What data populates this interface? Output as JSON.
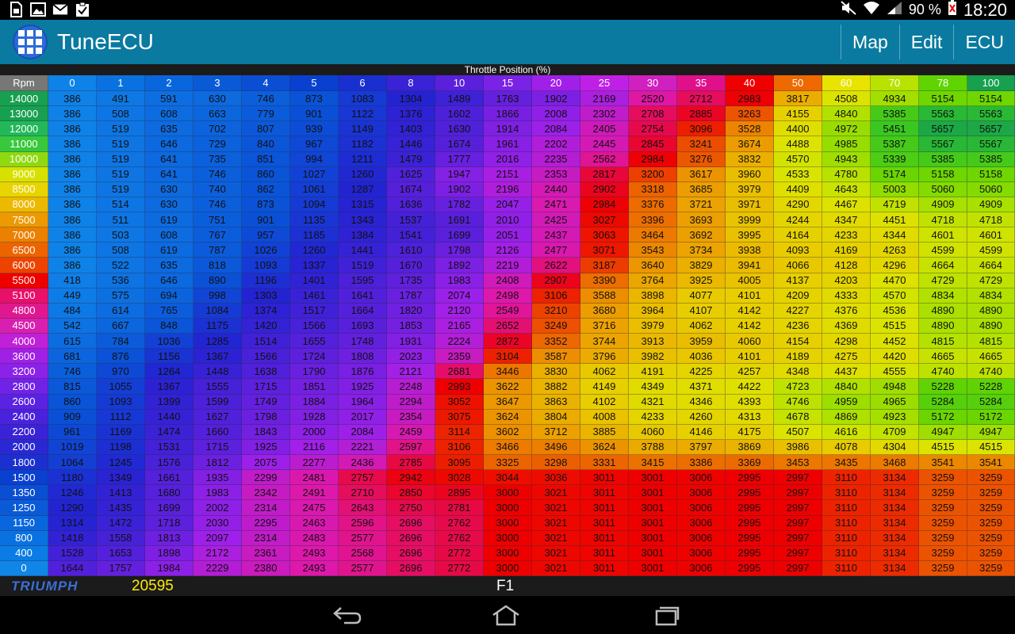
{
  "status_bar": {
    "left_icons": [
      "sim-card-icon",
      "image-icon",
      "gmail-icon",
      "clipboard-check-icon"
    ],
    "right_icons": [
      "mute-icon",
      "wifi-icon",
      "signal-icon"
    ],
    "battery": "90 %",
    "time": "18:20"
  },
  "app_bar": {
    "title": "TuneECU",
    "actions": [
      "Map",
      "Edit",
      "ECU"
    ]
  },
  "table": {
    "title": "Throttle Position (%)",
    "corner_label": "Rpm",
    "columns": [
      "0",
      "1",
      "2",
      "3",
      "4",
      "5",
      "6",
      "8",
      "10",
      "15",
      "20",
      "25",
      "30",
      "35",
      "40",
      "50",
      "60",
      "70",
      "78",
      "100"
    ],
    "column_colors": [
      "#0f82e8",
      "#0a72e0",
      "#0a66dd",
      "#0a5ad8",
      "#0a4ed4",
      "#0a40d0",
      "#1a2fd0",
      "#3a22d6",
      "#5a20dc",
      "#7a22e6",
      "#a020ea",
      "#c020e6",
      "#d020c0",
      "#e0108a",
      "#ee0000",
      "#ee6a00",
      "#e8e400",
      "#b8e200",
      "#60d400",
      "#17a050"
    ],
    "rows": [
      {
        "rpm": "14000",
        "color": "#17a050",
        "values": [
          386,
          491,
          591,
          630,
          746,
          873,
          1083,
          1304,
          1489,
          1763,
          1902,
          2169,
          2520,
          2712,
          2983,
          3817,
          4508,
          4934,
          5154,
          5154
        ]
      },
      {
        "rpm": "13000",
        "color": "#17a050",
        "values": [
          386,
          508,
          608,
          663,
          779,
          901,
          1122,
          1376,
          1602,
          1866,
          2008,
          2302,
          2708,
          2885,
          3263,
          4155,
          4840,
          5385,
          5563,
          5563
        ]
      },
      {
        "rpm": "12000",
        "color": "#22b85a",
        "values": [
          386,
          519,
          635,
          702,
          807,
          939,
          1149,
          1403,
          1630,
          1914,
          2084,
          2405,
          2754,
          3096,
          3528,
          4400,
          4972,
          5451,
          5657,
          5657
        ]
      },
      {
        "rpm": "11000",
        "color": "#38c83c",
        "values": [
          386,
          519,
          646,
          729,
          840,
          967,
          1182,
          1446,
          1674,
          1961,
          2202,
          2445,
          2845,
          3241,
          3674,
          4488,
          4985,
          5387,
          5567,
          5567
        ]
      },
      {
        "rpm": "10000",
        "color": "#90d810",
        "values": [
          386,
          519,
          641,
          735,
          851,
          994,
          1211,
          1479,
          1777,
          2016,
          2235,
          2562,
          2984,
          3276,
          3832,
          4570,
          4943,
          5339,
          5385,
          5385
        ]
      },
      {
        "rpm": "9000",
        "color": "#d8e000",
        "values": [
          386,
          519,
          641,
          746,
          860,
          1027,
          1260,
          1625,
          1947,
          2151,
          2353,
          2817,
          3200,
          3617,
          3960,
          4533,
          4780,
          5174,
          5158,
          5158
        ]
      },
      {
        "rpm": "8500",
        "color": "#e8d400",
        "values": [
          386,
          519,
          630,
          740,
          862,
          1061,
          1287,
          1674,
          1902,
          2196,
          2440,
          2902,
          3318,
          3685,
          3979,
          4409,
          4643,
          5003,
          5060,
          5060
        ]
      },
      {
        "rpm": "8000",
        "color": "#ecb800",
        "values": [
          386,
          514,
          630,
          746,
          873,
          1094,
          1315,
          1636,
          1782,
          2047,
          2471,
          2984,
          3376,
          3721,
          3971,
          4290,
          4467,
          4719,
          4909,
          4909
        ]
      },
      {
        "rpm": "7500",
        "color": "#ec9a00",
        "values": [
          386,
          511,
          619,
          751,
          901,
          1135,
          1343,
          1537,
          1691,
          2010,
          2425,
          3027,
          3396,
          3693,
          3999,
          4244,
          4347,
          4451,
          4718,
          4718
        ]
      },
      {
        "rpm": "7000",
        "color": "#ec8000",
        "values": [
          386,
          503,
          608,
          767,
          957,
          1185,
          1384,
          1541,
          1699,
          2051,
          2437,
          3063,
          3464,
          3692,
          3995,
          4164,
          4233,
          4344,
          4601,
          4601
        ]
      },
      {
        "rpm": "6500",
        "color": "#ec6400",
        "values": [
          386,
          508,
          619,
          787,
          1026,
          1260,
          1441,
          1610,
          1798,
          2126,
          2477,
          3071,
          3543,
          3734,
          3938,
          4093,
          4169,
          4263,
          4599,
          4599
        ]
      },
      {
        "rpm": "6000",
        "color": "#ec4400",
        "values": [
          386,
          522,
          635,
          818,
          1093,
          1337,
          1519,
          1670,
          1892,
          2219,
          2622,
          3187,
          3640,
          3829,
          3941,
          4066,
          4128,
          4296,
          4664,
          4664
        ]
      },
      {
        "rpm": "5500",
        "color": "#ee0000",
        "values": [
          418,
          536,
          646,
          890,
          1196,
          1401,
          1595,
          1735,
          1983,
          2408,
          2907,
          3390,
          3764,
          3925,
          4005,
          4137,
          4203,
          4470,
          4729,
          4729
        ]
      },
      {
        "rpm": "5100",
        "color": "#e8106a",
        "values": [
          449,
          575,
          694,
          998,
          1303,
          1461,
          1641,
          1787,
          2074,
          2498,
          3106,
          3588,
          3898,
          4077,
          4101,
          4209,
          4333,
          4570,
          4834,
          4834
        ]
      },
      {
        "rpm": "4800",
        "color": "#e01890",
        "values": [
          484,
          614,
          765,
          1084,
          1374,
          1517,
          1664,
          1820,
          2120,
          2549,
          3210,
          3680,
          3964,
          4107,
          4142,
          4227,
          4376,
          4536,
          4890,
          4890
        ]
      },
      {
        "rpm": "4500",
        "color": "#d820b0",
        "values": [
          542,
          667,
          848,
          1175,
          1420,
          1566,
          1693,
          1853,
          2165,
          2652,
          3249,
          3716,
          3979,
          4062,
          4142,
          4236,
          4369,
          4515,
          4890,
          4890
        ]
      },
      {
        "rpm": "4000",
        "color": "#c020d8",
        "values": [
          615,
          784,
          1036,
          1285,
          1514,
          1655,
          1748,
          1931,
          2224,
          2872,
          3352,
          3744,
          3913,
          3959,
          4060,
          4154,
          4298,
          4452,
          4815,
          4815
        ]
      },
      {
        "rpm": "3600",
        "color": "#a020e6",
        "values": [
          681,
          876,
          1156,
          1367,
          1566,
          1724,
          1808,
          2023,
          2359,
          3104,
          3587,
          3796,
          3982,
          4036,
          4101,
          4189,
          4275,
          4420,
          4665,
          4665
        ]
      },
      {
        "rpm": "3200",
        "color": "#8a22e8",
        "values": [
          746,
          970,
          1264,
          1448,
          1638,
          1790,
          1876,
          2121,
          2681,
          3446,
          3830,
          4062,
          4191,
          4225,
          4257,
          4348,
          4437,
          4555,
          4740,
          4740
        ]
      },
      {
        "rpm": "2800",
        "color": "#7022e6",
        "values": [
          815,
          1055,
          1367,
          1555,
          1715,
          1851,
          1925,
          2248,
          2993,
          3622,
          3882,
          4149,
          4349,
          4371,
          4422,
          4723,
          4840,
          4948,
          5228,
          5228
        ]
      },
      {
        "rpm": "2600",
        "color": "#5a22e2",
        "values": [
          860,
          1093,
          1399,
          1599,
          1749,
          1884,
          1964,
          2294,
          3052,
          3647,
          3863,
          4102,
          4321,
          4346,
          4393,
          4746,
          4959,
          4965,
          5284,
          5284
        ]
      },
      {
        "rpm": "2400",
        "color": "#4a22dc",
        "values": [
          909,
          1112,
          1440,
          1627,
          1798,
          1928,
          2017,
          2354,
          3075,
          3624,
          3804,
          4008,
          4233,
          4260,
          4313,
          4678,
          4869,
          4923,
          5172,
          5172
        ]
      },
      {
        "rpm": "2200",
        "color": "#3a22d6",
        "values": [
          961,
          1169,
          1474,
          1660,
          1843,
          2000,
          2084,
          2459,
          3114,
          3602,
          3712,
          3885,
          4060,
          4146,
          4175,
          4507,
          4616,
          4709,
          4947,
          4947
        ]
      },
      {
        "rpm": "2000",
        "color": "#2a28d2",
        "values": [
          1019,
          1198,
          1531,
          1715,
          1925,
          2116,
          2221,
          2597,
          3106,
          3466,
          3496,
          3624,
          3788,
          3797,
          3869,
          3986,
          4078,
          4304,
          4515,
          4515
        ]
      },
      {
        "rpm": "1800",
        "color": "#1a30d0",
        "values": [
          1064,
          1245,
          1576,
          1812,
          2075,
          2277,
          2436,
          2785,
          3095,
          3325,
          3298,
          3331,
          3415,
          3386,
          3369,
          3453,
          3435,
          3468,
          3541,
          3541
        ]
      },
      {
        "rpm": "1500",
        "color": "#0a40d0",
        "values": [
          1180,
          1349,
          1661,
          1935,
          2299,
          2481,
          2757,
          2942,
          3028,
          3044,
          3036,
          3011,
          3001,
          3006,
          2995,
          2997,
          3110,
          3134,
          3259,
          3259
        ]
      },
      {
        "rpm": "1350",
        "color": "#0a4ed4",
        "values": [
          1246,
          1413,
          1680,
          1983,
          2342,
          2491,
          2710,
          2850,
          2895,
          3000,
          3021,
          3011,
          3001,
          3006,
          2995,
          2997,
          3110,
          3134,
          3259,
          3259
        ]
      },
      {
        "rpm": "1250",
        "color": "#0a5ad8",
        "values": [
          1290,
          1435,
          1699,
          2002,
          2314,
          2475,
          2643,
          2750,
          2781,
          3000,
          3021,
          3011,
          3001,
          3006,
          2995,
          2997,
          3110,
          3134,
          3259,
          3259
        ]
      },
      {
        "rpm": "1150",
        "color": "#0a66dd",
        "values": [
          1314,
          1472,
          1718,
          2030,
          2295,
          2463,
          2596,
          2696,
          2762,
          3000,
          3021,
          3011,
          3001,
          3006,
          2995,
          2997,
          3110,
          3134,
          3259,
          3259
        ]
      },
      {
        "rpm": "800",
        "color": "#0a72e0",
        "values": [
          1418,
          1558,
          1813,
          2097,
          2314,
          2483,
          2577,
          2696,
          2762,
          3000,
          3021,
          3011,
          3001,
          3006,
          2995,
          2997,
          3110,
          3134,
          3259,
          3259
        ]
      },
      {
        "rpm": "400",
        "color": "#0a7ce4",
        "values": [
          1528,
          1653,
          1898,
          2172,
          2361,
          2493,
          2568,
          2696,
          2772,
          3000,
          3021,
          3011,
          3001,
          3006,
          2995,
          2997,
          3110,
          3134,
          3259,
          3259
        ]
      },
      {
        "rpm": "0",
        "color": "#0f86e8",
        "values": [
          1644,
          1757,
          1984,
          2229,
          2380,
          2493,
          2577,
          2696,
          2772,
          3000,
          3021,
          3011,
          3001,
          3006,
          2995,
          2997,
          3110,
          3134,
          3259,
          3259
        ]
      }
    ]
  },
  "footer": {
    "brand": "TRIUMPH",
    "odometer": "20595",
    "function_key": "F1"
  },
  "nav_icons": [
    "back-icon",
    "home-icon",
    "recent-apps-icon"
  ]
}
